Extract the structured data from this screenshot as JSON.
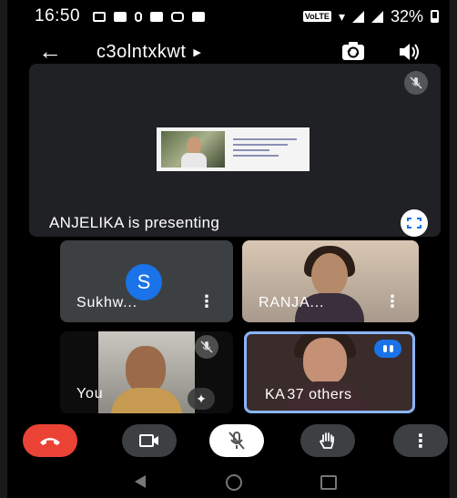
{
  "status_bar": {
    "time": "16:50",
    "battery": "32%"
  },
  "app_bar": {
    "title": "c3olntxkwt"
  },
  "presentation": {
    "label": "ANJELIKA is presenting"
  },
  "participants": [
    {
      "name": "Sukhw...",
      "avatar_letter": "S"
    },
    {
      "name": "RANJA..."
    },
    {
      "name": "You"
    },
    {
      "name": "KA",
      "others_label": "37 others"
    }
  ],
  "colors": {
    "hangup": "#ea4335",
    "accent": "#1a73e8",
    "tile": "#3c4043"
  },
  "controls": [
    "hangup-icon",
    "camera-icon",
    "mic-off-icon",
    "raise-hand-icon",
    "more-vert-icon"
  ]
}
